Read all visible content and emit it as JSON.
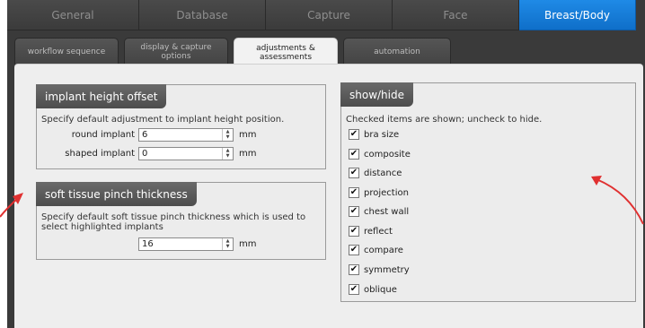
{
  "top_tabs": [
    {
      "label": "General"
    },
    {
      "label": "Database"
    },
    {
      "label": "Capture"
    },
    {
      "label": "Face"
    },
    {
      "label": "Breast/Body"
    }
  ],
  "sub_tabs": [
    {
      "label": "workflow sequence"
    },
    {
      "label": "display & capture options"
    },
    {
      "label": "adjustments & assessments"
    },
    {
      "label": "automation"
    }
  ],
  "implant_height": {
    "title": "implant height offset",
    "description": "Specify default adjustment to implant height position.",
    "round_label": "round implant",
    "round_value": "6",
    "shaped_label": "shaped implant",
    "shaped_value": "0",
    "unit": "mm"
  },
  "pinch": {
    "title": "soft tissue pinch thickness",
    "description_line1": "Specify default soft tissue pinch thickness which is used to",
    "description_line2": "select highlighted implants",
    "value": "16",
    "unit": "mm"
  },
  "showhide": {
    "title": "show/hide",
    "description": "Checked items are shown; uncheck to hide.",
    "items": [
      {
        "label": "bra size",
        "checked": true
      },
      {
        "label": "composite",
        "checked": true
      },
      {
        "label": "distance",
        "checked": true
      },
      {
        "label": "projection",
        "checked": true
      },
      {
        "label": "chest wall",
        "checked": true
      },
      {
        "label": "reflect",
        "checked": true
      },
      {
        "label": "compare",
        "checked": true
      },
      {
        "label": "symmetry",
        "checked": true
      },
      {
        "label": "oblique",
        "checked": true
      }
    ]
  },
  "colors": {
    "active_tab": "#1a7fdc",
    "annotation_arrow": "#e03030"
  }
}
